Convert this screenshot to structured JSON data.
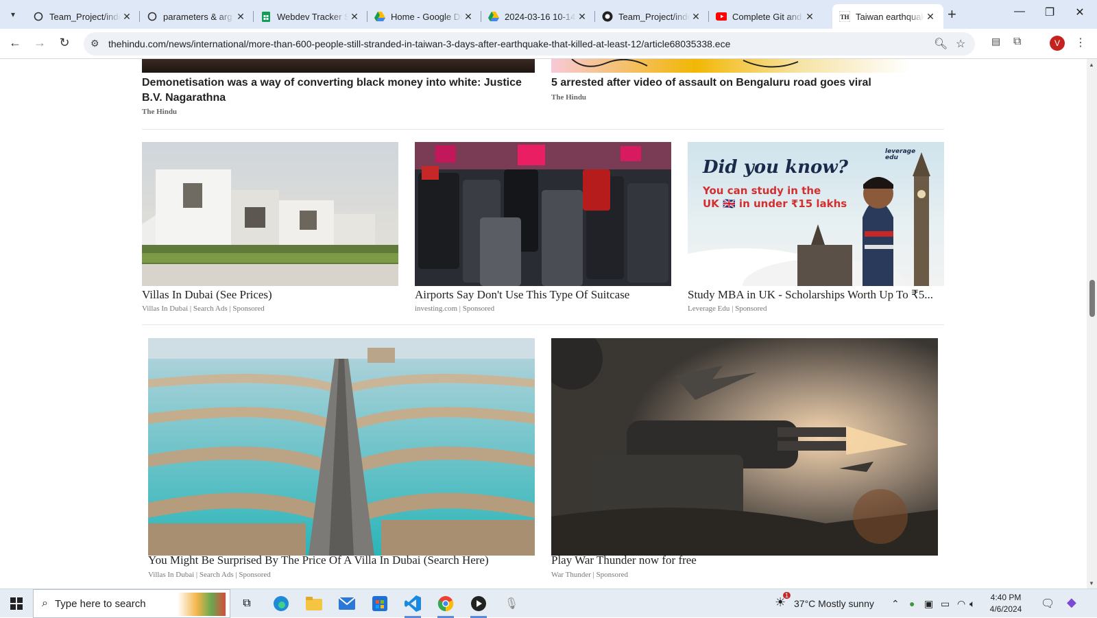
{
  "browser": {
    "tabs": [
      {
        "label": "Team_Project/inde",
        "icon": "github-circle-icon"
      },
      {
        "label": "parameters & arg",
        "icon": "github-circle-icon"
      },
      {
        "label": "Webdev Tracker Sh",
        "icon": "google-sheets-icon"
      },
      {
        "label": "Home - Google Dr",
        "icon": "google-drive-icon"
      },
      {
        "label": "2024-03-16 10-14",
        "icon": "google-drive-icon"
      },
      {
        "label": "Team_Project/inde",
        "icon": "github-icon"
      },
      {
        "label": "Complete Git and",
        "icon": "youtube-icon"
      },
      {
        "label": "Taiwan earthquake",
        "icon": "the-hindu-icon"
      }
    ],
    "close_glyph": "✕",
    "url": "thehindu.com/news/international/more-than-600-people-still-stranded-in-taiwan-3-days-after-earthquake-that-killed-at-least-12/article68035338.ece",
    "profile_initial": "V"
  },
  "page": {
    "news": [
      {
        "headline": "Demonetisation was a way of converting black money into white: Justice B.V. Nagarathna",
        "source": "The Hindu"
      },
      {
        "headline": "5 arrested after video of assault on Bengaluru road goes viral",
        "source": "The Hindu"
      }
    ],
    "ads_row1": [
      {
        "title": "Villas In Dubai (See Prices)",
        "meta": "Villas In Dubai | Search Ads | Sponsored"
      },
      {
        "title": "Airports Say Don't Use This Type Of Suitcase",
        "meta": "investing.com | Sponsored"
      },
      {
        "title": "Study MBA in UK - Scholarships Worth Up To ₹5...",
        "meta": "Leverage Edu | Sponsored"
      }
    ],
    "ad_banner": {
      "heading": "Did you know?",
      "line1": "You can study in the",
      "line2": "UK 🇬🇧 in under ₹15 lakhs",
      "brand": "leverage edu"
    },
    "ads_row2": [
      {
        "title": "You Might Be Surprised By The Price Of A Villa In Dubai (Search Here)",
        "meta": "Villas In Dubai | Search Ads | Sponsored"
      },
      {
        "title": "Play War Thunder now for free",
        "meta": "War Thunder | Sponsored"
      }
    ]
  },
  "taskbar": {
    "search_placeholder": "Type here to search",
    "weather": "37°C  Mostly sunny",
    "weather_badge": "1",
    "time": "4:40 PM",
    "date": "4/6/2024"
  }
}
